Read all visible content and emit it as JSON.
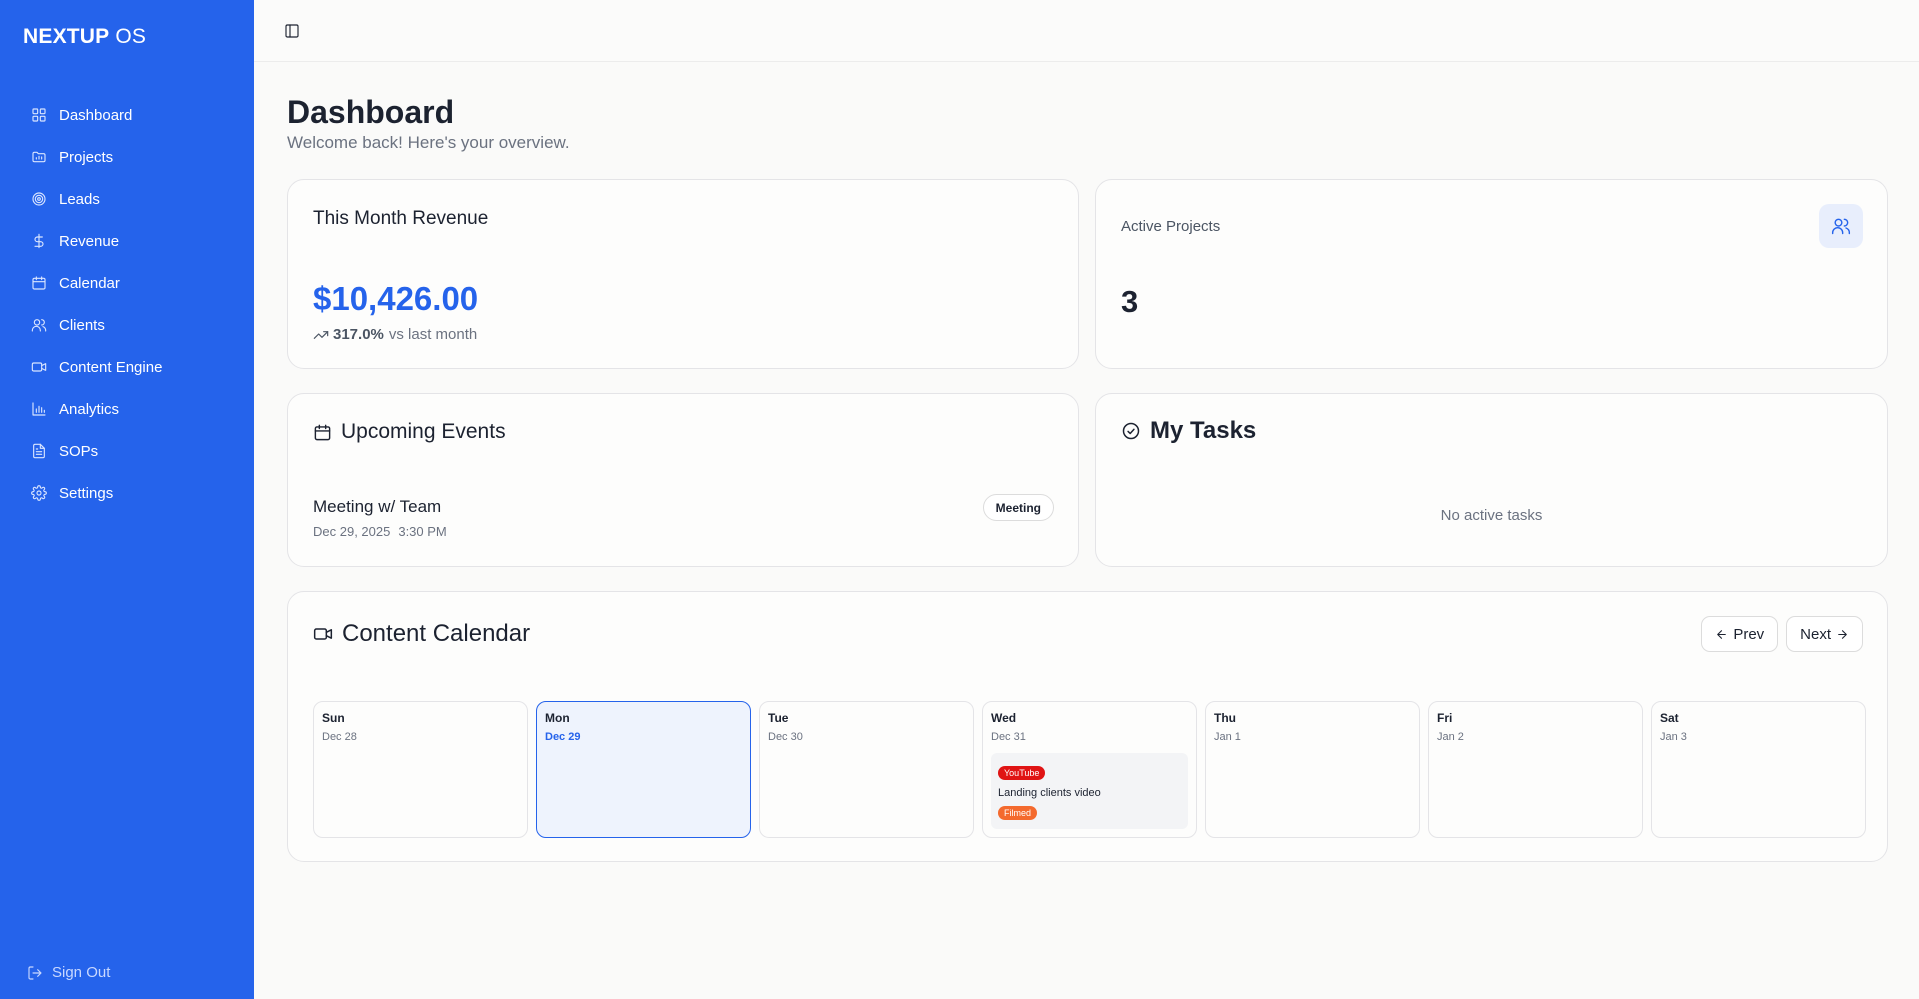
{
  "app": {
    "brand_bold": "NEXTUP",
    "brand_light": "OS"
  },
  "sidebar": {
    "items": [
      {
        "label": "Dashboard",
        "icon": "layout-grid-icon"
      },
      {
        "label": "Projects",
        "icon": "folder-icon"
      },
      {
        "label": "Leads",
        "icon": "target-icon"
      },
      {
        "label": "Revenue",
        "icon": "dollar-icon"
      },
      {
        "label": "Calendar",
        "icon": "calendar-icon"
      },
      {
        "label": "Clients",
        "icon": "users-icon"
      },
      {
        "label": "Content Engine",
        "icon": "video-icon"
      },
      {
        "label": "Analytics",
        "icon": "bar-chart-icon"
      },
      {
        "label": "SOPs",
        "icon": "file-text-icon"
      },
      {
        "label": "Settings",
        "icon": "gear-icon"
      }
    ],
    "sign_out": "Sign Out",
    "colors": {
      "background": "#2563eb"
    }
  },
  "header": {
    "title": "Dashboard",
    "subtitle": "Welcome back! Here's your overview."
  },
  "revenue": {
    "title": "This Month Revenue",
    "amount": "$10,426.00",
    "change": "317.0%",
    "change_suffix": "vs last month"
  },
  "active_projects": {
    "title": "Active Projects",
    "value": "3"
  },
  "upcoming_events": {
    "title": "Upcoming Events",
    "items": [
      {
        "title": "Meeting w/ Team",
        "date": "Dec 29, 2025",
        "time": "3:30 PM",
        "type": "Meeting"
      }
    ]
  },
  "my_tasks": {
    "title": "My Tasks",
    "empty_text": "No active tasks"
  },
  "content_calendar": {
    "title": "Content Calendar",
    "prev_label": "Prev",
    "next_label": "Next",
    "days": [
      {
        "name": "Sun",
        "date": "Dec 28"
      },
      {
        "name": "Mon",
        "date": "Dec 29",
        "today": true
      },
      {
        "name": "Tue",
        "date": "Dec 30"
      },
      {
        "name": "Wed",
        "date": "Dec 31",
        "post": {
          "platform": "YouTube",
          "title": "Landing clients video",
          "status": "Filmed"
        }
      },
      {
        "name": "Thu",
        "date": "Jan 1"
      },
      {
        "name": "Fri",
        "date": "Jan 2"
      },
      {
        "name": "Sat",
        "date": "Jan 3"
      }
    ],
    "colors": {
      "accent": "#2563eb",
      "youtube": "#e01414",
      "filmed": "#f46a2e"
    }
  }
}
